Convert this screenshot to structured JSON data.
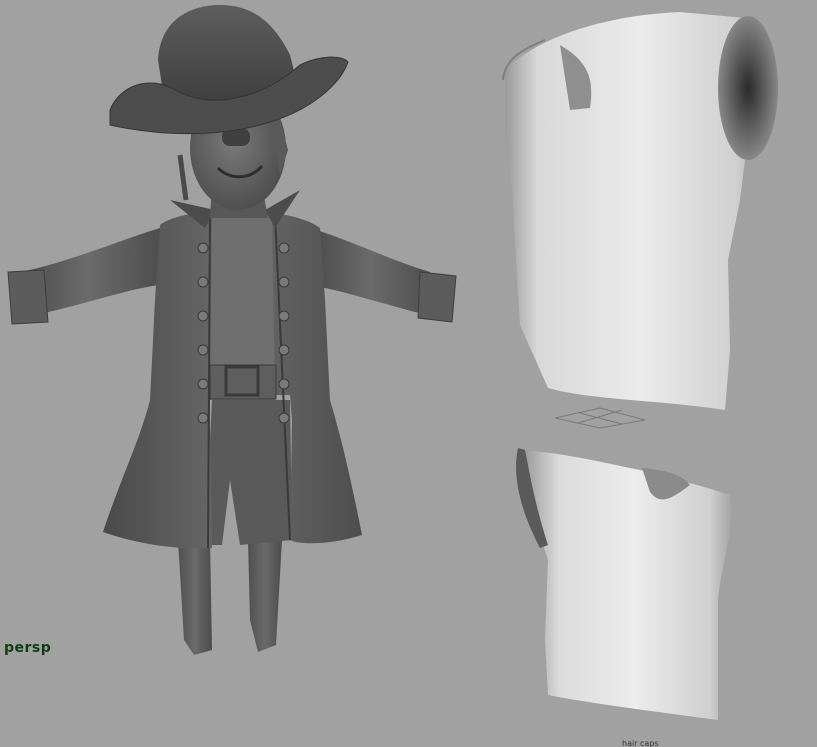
{
  "viewport": {
    "camera_name": "persp",
    "bottom_label": "hair caps"
  },
  "colors": {
    "background": "#a1a1a1",
    "model_dark": "#555555",
    "model_mid": "#6e6e6e",
    "shirt_light": "#e4e4e4",
    "camera_label": "#0d3d12"
  },
  "objects": [
    {
      "name": "pirate-character",
      "shading": "smooth"
    },
    {
      "name": "shirt-mesh-front",
      "shading": "smooth"
    },
    {
      "name": "shirt-mesh-side",
      "shading": "smooth"
    }
  ]
}
